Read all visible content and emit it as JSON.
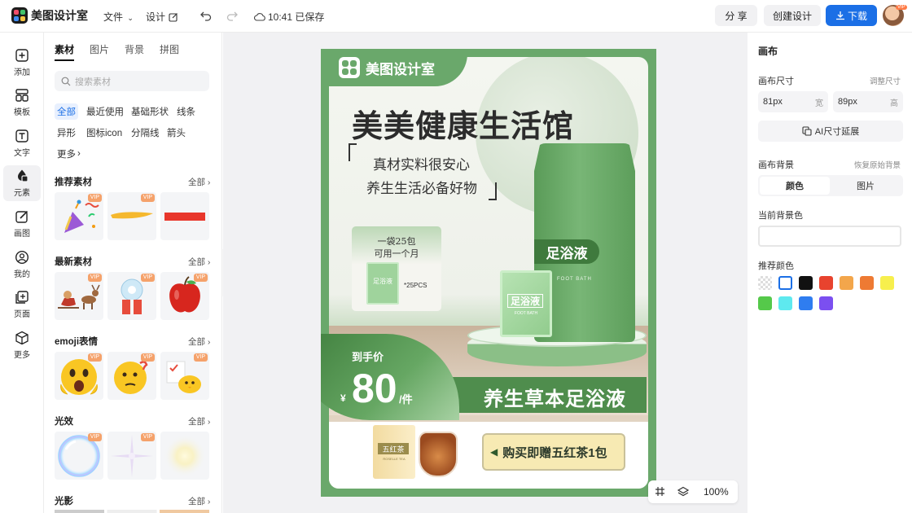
{
  "topbar": {
    "app_name": "美图设计室",
    "menu_file": "文件",
    "menu_design": "设计",
    "save_status": "10:41 已保存",
    "share": "分 享",
    "create_design": "创建设计",
    "download": "下载",
    "avatar_badge": "VIP"
  },
  "leftnav": {
    "items": [
      {
        "label": "添加",
        "icon": "plus-square-icon"
      },
      {
        "label": "模板",
        "icon": "template-icon"
      },
      {
        "label": "文字",
        "icon": "text-icon"
      },
      {
        "label": "元素",
        "icon": "shapes-icon"
      },
      {
        "label": "画图",
        "icon": "pencil-icon"
      },
      {
        "label": "我的",
        "icon": "user-icon"
      },
      {
        "label": "页面",
        "icon": "add-page-icon"
      },
      {
        "label": "更多",
        "icon": "cube-icon"
      }
    ]
  },
  "panel": {
    "tabs": [
      "素材",
      "图片",
      "背景",
      "拼图"
    ],
    "search_placeholder": "搜索素材",
    "chips": [
      "全部",
      "最近使用",
      "基础形状",
      "线条",
      "异形",
      "图标icon",
      "分隔线",
      "箭头",
      "更多"
    ],
    "all_label": "全部",
    "vip_label": "VIP",
    "sections": [
      "推荐素材",
      "最新素材",
      "emoji表情",
      "光效",
      "光影"
    ]
  },
  "poster": {
    "brand": "美图设计室",
    "headline": "美美健康生活馆",
    "slogan_line1": "真材实料很安心",
    "slogan_line2": "养生生活必备好物",
    "small_pack_line1": "一袋25包",
    "small_pack_line2": "可用一个月",
    "small_pack_label": "足浴液",
    "pcs": "*25PCS",
    "bag_label": "足浴液",
    "bag_sub": "FOOT BATH",
    "box_label": "足浴液",
    "box_sub": "FOOT BATH",
    "price_label": "到手价",
    "currency": "¥",
    "price": "80",
    "unit": "/件",
    "product_name": "养生草本足浴液",
    "gift_pack": "五红茶",
    "gift_pack_sub": "ROSELLE TEA",
    "gift_text": "购买即赠五红茶1包"
  },
  "rpanel": {
    "title": "画布",
    "size_label": "画布尺寸",
    "resize_link": "调整尺寸",
    "width_value": "81px",
    "width_unit": "宽",
    "height_value": "89px",
    "height_unit": "高",
    "ai_extend": "AI尺寸延展",
    "bg_label": "画布背景",
    "restore_bg": "恢复原始背景",
    "bg_tab_color": "颜色",
    "bg_tab_image": "图片",
    "current_bg": "当前背景色",
    "recommended": "推荐颜色",
    "swatches": [
      "transparent",
      "#ffffff",
      "#111111",
      "#e8432e",
      "#f3a64b",
      "#ee7a33",
      "#f7ef4d",
      "#55c94a",
      "#5ee9ef",
      "#2f7df0",
      "#7b4ff0"
    ]
  },
  "zoom": {
    "value": "100%"
  }
}
